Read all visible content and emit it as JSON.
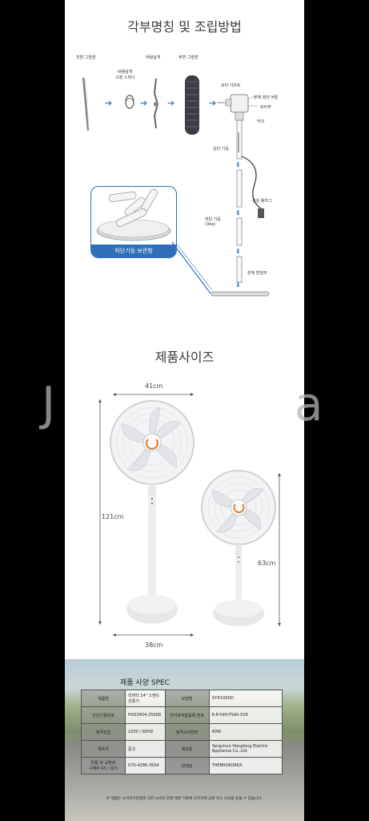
{
  "assembly": {
    "title": "각부명칭 및 조립방법",
    "labels": {
      "front_grill": "전면 그릴망",
      "blade_fix": "바람날개\n고정 스피너",
      "blade": "바람날개",
      "rear_grill": "후면 그릴망",
      "motor_shaft": "모터 샤프트",
      "rotate_button": "본체 회전 버튼",
      "motor": "모터부",
      "neck": "넥크",
      "upper_pole": "상단 기둥",
      "power_plug": "전원 플러그",
      "lower_pole": "하단 기둥\n(3ea)",
      "base": "본체 받침부",
      "storage_caption": "하단기둥 보관함"
    }
  },
  "size": {
    "title": "제품사이즈",
    "width_large": "41cm",
    "height_large": "121cm",
    "base_width": "38cm",
    "height_small": "63cm"
  },
  "watermark": {
    "left": "J",
    "right": "a"
  },
  "spec": {
    "title": "제품 사양 SPEC",
    "rows": [
      {
        "k1": "제품명",
        "v1": "리버티 14\" 스탠드 선풍기",
        "k2": "모델명",
        "v2": "SY-E1000D"
      },
      {
        "k1": "안전인증번호",
        "v1": "HU03454-25008",
        "k2": "전자파적합등록 번호",
        "v2": "R-R-YdH-FS40-01R"
      },
      {
        "k1": "정격전압",
        "v1": "220V / 60HZ",
        "k2": "정격소비전력",
        "v2": "40W"
      },
      {
        "k1": "제조국",
        "v1": "중국",
        "k2": "제조원",
        "v2": "Yangchun Hongfeng Electric Appliance Co.,Ltd."
      },
      {
        "k1": "반품 및 교환처\n구매처 AS / 문의",
        "v1": "070-4286-3504",
        "k2": "판매원",
        "v2": "THEBROKOREA"
      }
    ],
    "note": "본 제품은 소비자기본법에 의한 소비자 분쟁 해결 기준에 의거하여 교환 또는 보상을 받을 수 있습니다."
  },
  "colors": {
    "accent_blue": "#2f7fd3",
    "fan_gray": "#e9eaec",
    "hub_orange": "#d9823a"
  }
}
